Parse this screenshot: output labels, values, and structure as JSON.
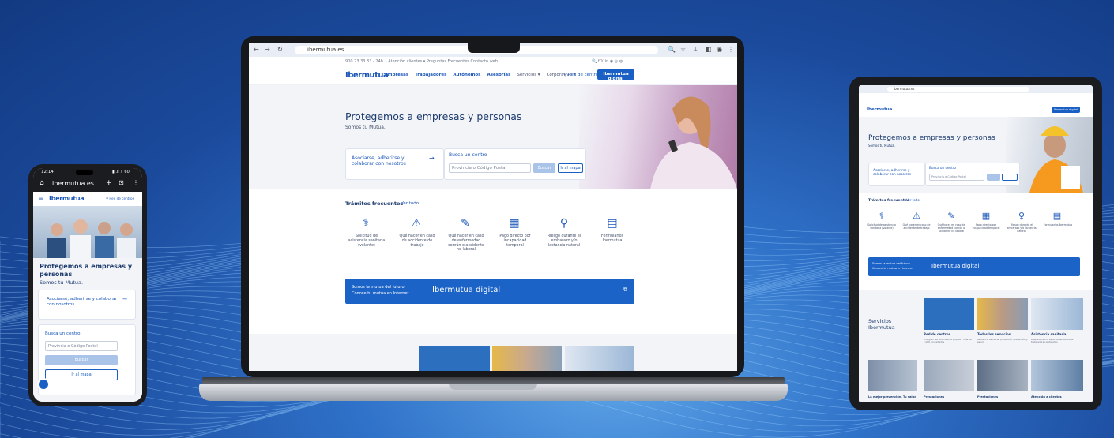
{
  "laptop": {
    "url": "ibermutua.es",
    "topbar": {
      "left": "900 23 33 33 - 24h.  ·  Atención clientes  ▾   Preguntas Frecuentes   Contacto web",
      "right": "🔍  f  𝕏  in  ◉  ◎  ◍"
    },
    "nav": {
      "logo": "Ibermutua",
      "items": [
        "Empresas",
        "Trabajadores",
        "Autónomos",
        "Asesorías",
        "Servicios  ▾",
        "Corporativo  ▾"
      ],
      "centers": "⚲ Red de centros",
      "digital": "Ibermutua digital"
    },
    "hero": {
      "title": "Protegemos a empresas y personas",
      "subtitle": "Somos tu Mutua.",
      "card_link": "Asociarse, adherirse y colaborar con nosotros",
      "search_title": "Busca un centro",
      "search_placeholder": "Provincia o Código Postal",
      "search_btn": "Buscar",
      "map_btn": "Ir al mapa"
    },
    "tramites": {
      "title": "Trámites frecuentes",
      "see_all": "Ver todo",
      "items": [
        "Solicitud de asistencia sanitaria (volante)",
        "Qué hacer en caso de accidente de trabajo",
        "Qué hacer en caso de enfermedad común o accidente no laboral",
        "Pago directo por incapacidad temporal",
        "Riesgo durante el embarazo y/o lactancia natural",
        "Formularios Ibermutua"
      ]
    },
    "banner": {
      "line1": "Somos la mutua del futuro",
      "line2": "Conoce tu mutua en Internet",
      "brand": "Ibermutua digital"
    }
  },
  "tablet": {
    "url": "ibermutua.es",
    "hero_title": "Protegemos a empresas y personas",
    "hero_sub": "Somos tu Mutua.",
    "card_link": "Asociarse, adherirse y colaborar con nosotros",
    "search_title": "Busca un centro",
    "search_placeholder": "Provincia o Código Postal",
    "tramites_title": "Trámites frecuentes",
    "see_all": "Ver todo",
    "tramites": [
      "Solicitud de asistencia sanitaria (volante)",
      "Qué hacer en caso de accidente de trabajo",
      "Qué hacer en caso de enfermedad común o accidente no laboral",
      "Pago directo por incapacidad temporal",
      "Riesgo durante el embarazo y/o lactancia natural",
      "Formularios Ibermutua"
    ],
    "banner_line1": "Somos la mutua del futuro",
    "banner_line2": "Conoce tu mutua en Internet",
    "banner_brand": "Ibermutua digital",
    "services_title": "Servicios Ibermutua",
    "services": [
      {
        "title": "Red de centros",
        "desc": "Una gran red 100 centros propios y más de 1.000 concertados"
      },
      {
        "title": "Todos los servicios",
        "desc": "Asistencia sanitaria, protección, prevención y salud"
      },
      {
        "title": "Asistencia sanitaria",
        "desc": "Respaldamos la salud de las personas trabajadoras protegidas"
      }
    ],
    "bottom": [
      "La mejor prevención. Tu salud",
      "Prestaciones",
      "Prestaciones",
      "Atención a clientes"
    ]
  },
  "phone": {
    "time": "12:14",
    "status_icons": "▮ .ıl ⚡ 60",
    "url": "ibermutua.es",
    "logo": "Ibermutua",
    "centers": "⚲ Red de centros",
    "hero_title": "Protegemos a empresas y personas",
    "hero_sub": "Somos tu Mutua.",
    "card_link": "Asociarse, adherirse y colaborar con nosotros",
    "search_title": "Busca un centro",
    "search_placeholder": "Provincia o Código Postal",
    "search_btn": "Buscar",
    "map_btn": "Ir al mapa"
  }
}
